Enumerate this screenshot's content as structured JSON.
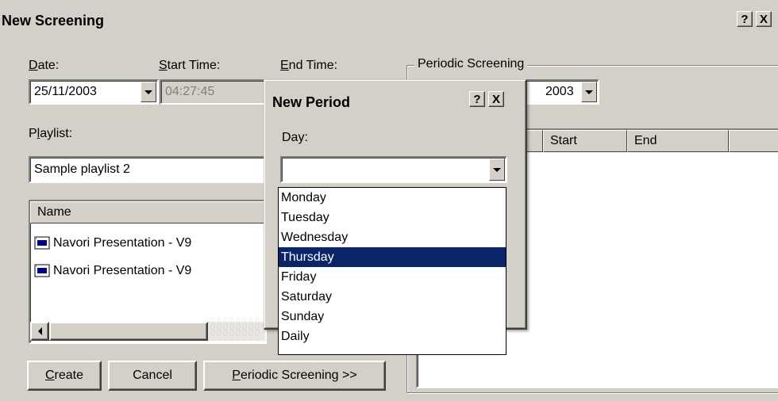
{
  "window": {
    "title": "New Screening",
    "help_label": "?",
    "close_label": "X"
  },
  "fields": {
    "date_label": "Date:",
    "date_value": "25/11/2003",
    "start_time_label": "Start Time:",
    "start_time_value": "04:27:45",
    "end_time_label": "End Time:",
    "playlist_label": "Playlist:",
    "playlist_value": "Sample playlist 2"
  },
  "media_list": {
    "column_name": "Name",
    "items": [
      "Navori Presentation - V9",
      "Navori Presentation - V9"
    ]
  },
  "buttons": {
    "create": "Create",
    "cancel": "Cancel",
    "periodic": "Periodic Screening >>"
  },
  "periodic": {
    "group_label": "Periodic Screening",
    "date_fragment": "2003",
    "columns": [
      "Start",
      "End"
    ]
  },
  "new_period": {
    "title": "New Period",
    "help_label": "?",
    "close_label": "X",
    "day_label": "Day:",
    "day_value": "",
    "options": [
      "Monday",
      "Tuesday",
      "Wednesday",
      "Thursday",
      "Friday",
      "Saturday",
      "Sunday",
      "Daily"
    ],
    "selected_option": "Thursday"
  },
  "colors": {
    "face": "#d4d0c8",
    "highlight": "#0a246a"
  }
}
